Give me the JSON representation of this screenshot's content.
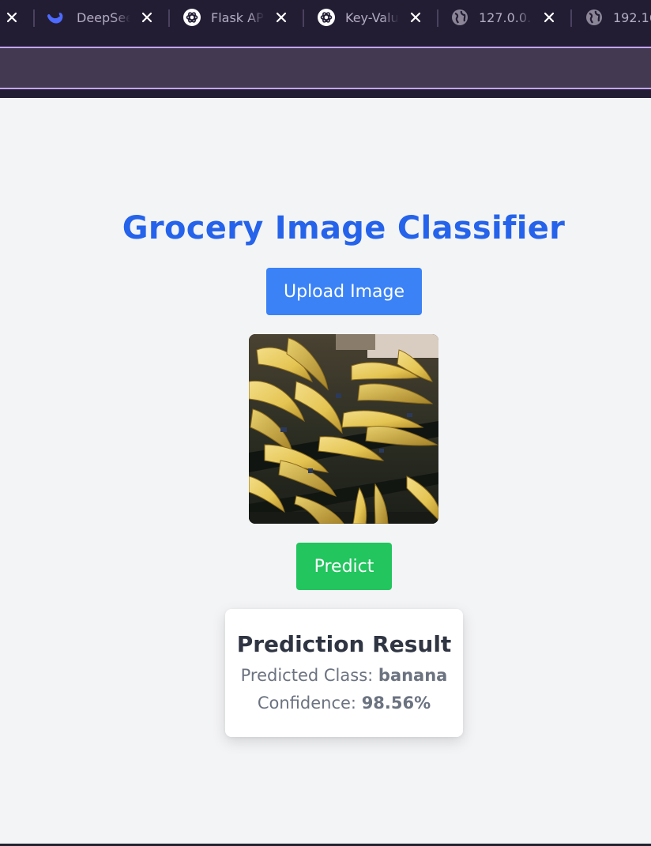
{
  "browser": {
    "tabs": [
      {
        "title": "DeepSeek",
        "favicon": "deepseek-whale-icon"
      },
      {
        "title": "Flask API",
        "favicon": "openai-icon"
      },
      {
        "title": "Key-Value",
        "favicon": "openai-icon"
      },
      {
        "title": "127.0.0.1",
        "favicon": "globe-icon"
      },
      {
        "title": "192.168",
        "favicon": "globe-icon"
      }
    ],
    "colors": {
      "chrome": "#231d34",
      "toolbar": "#433a52",
      "accent": "#c5a6f4"
    }
  },
  "app": {
    "title": "Grocery Image Classifier",
    "upload_label": "Upload Image",
    "predict_label": "Predict",
    "image_subject": "bananas-on-shelf",
    "colors": {
      "title": "#2563eb",
      "upload": "#3b82f6",
      "predict": "#22c55e"
    }
  },
  "result": {
    "heading": "Prediction Result",
    "class_label": "Predicted Class:",
    "class_value": "banana",
    "confidence_label": "Confidence:",
    "confidence_value": "98.56%"
  }
}
